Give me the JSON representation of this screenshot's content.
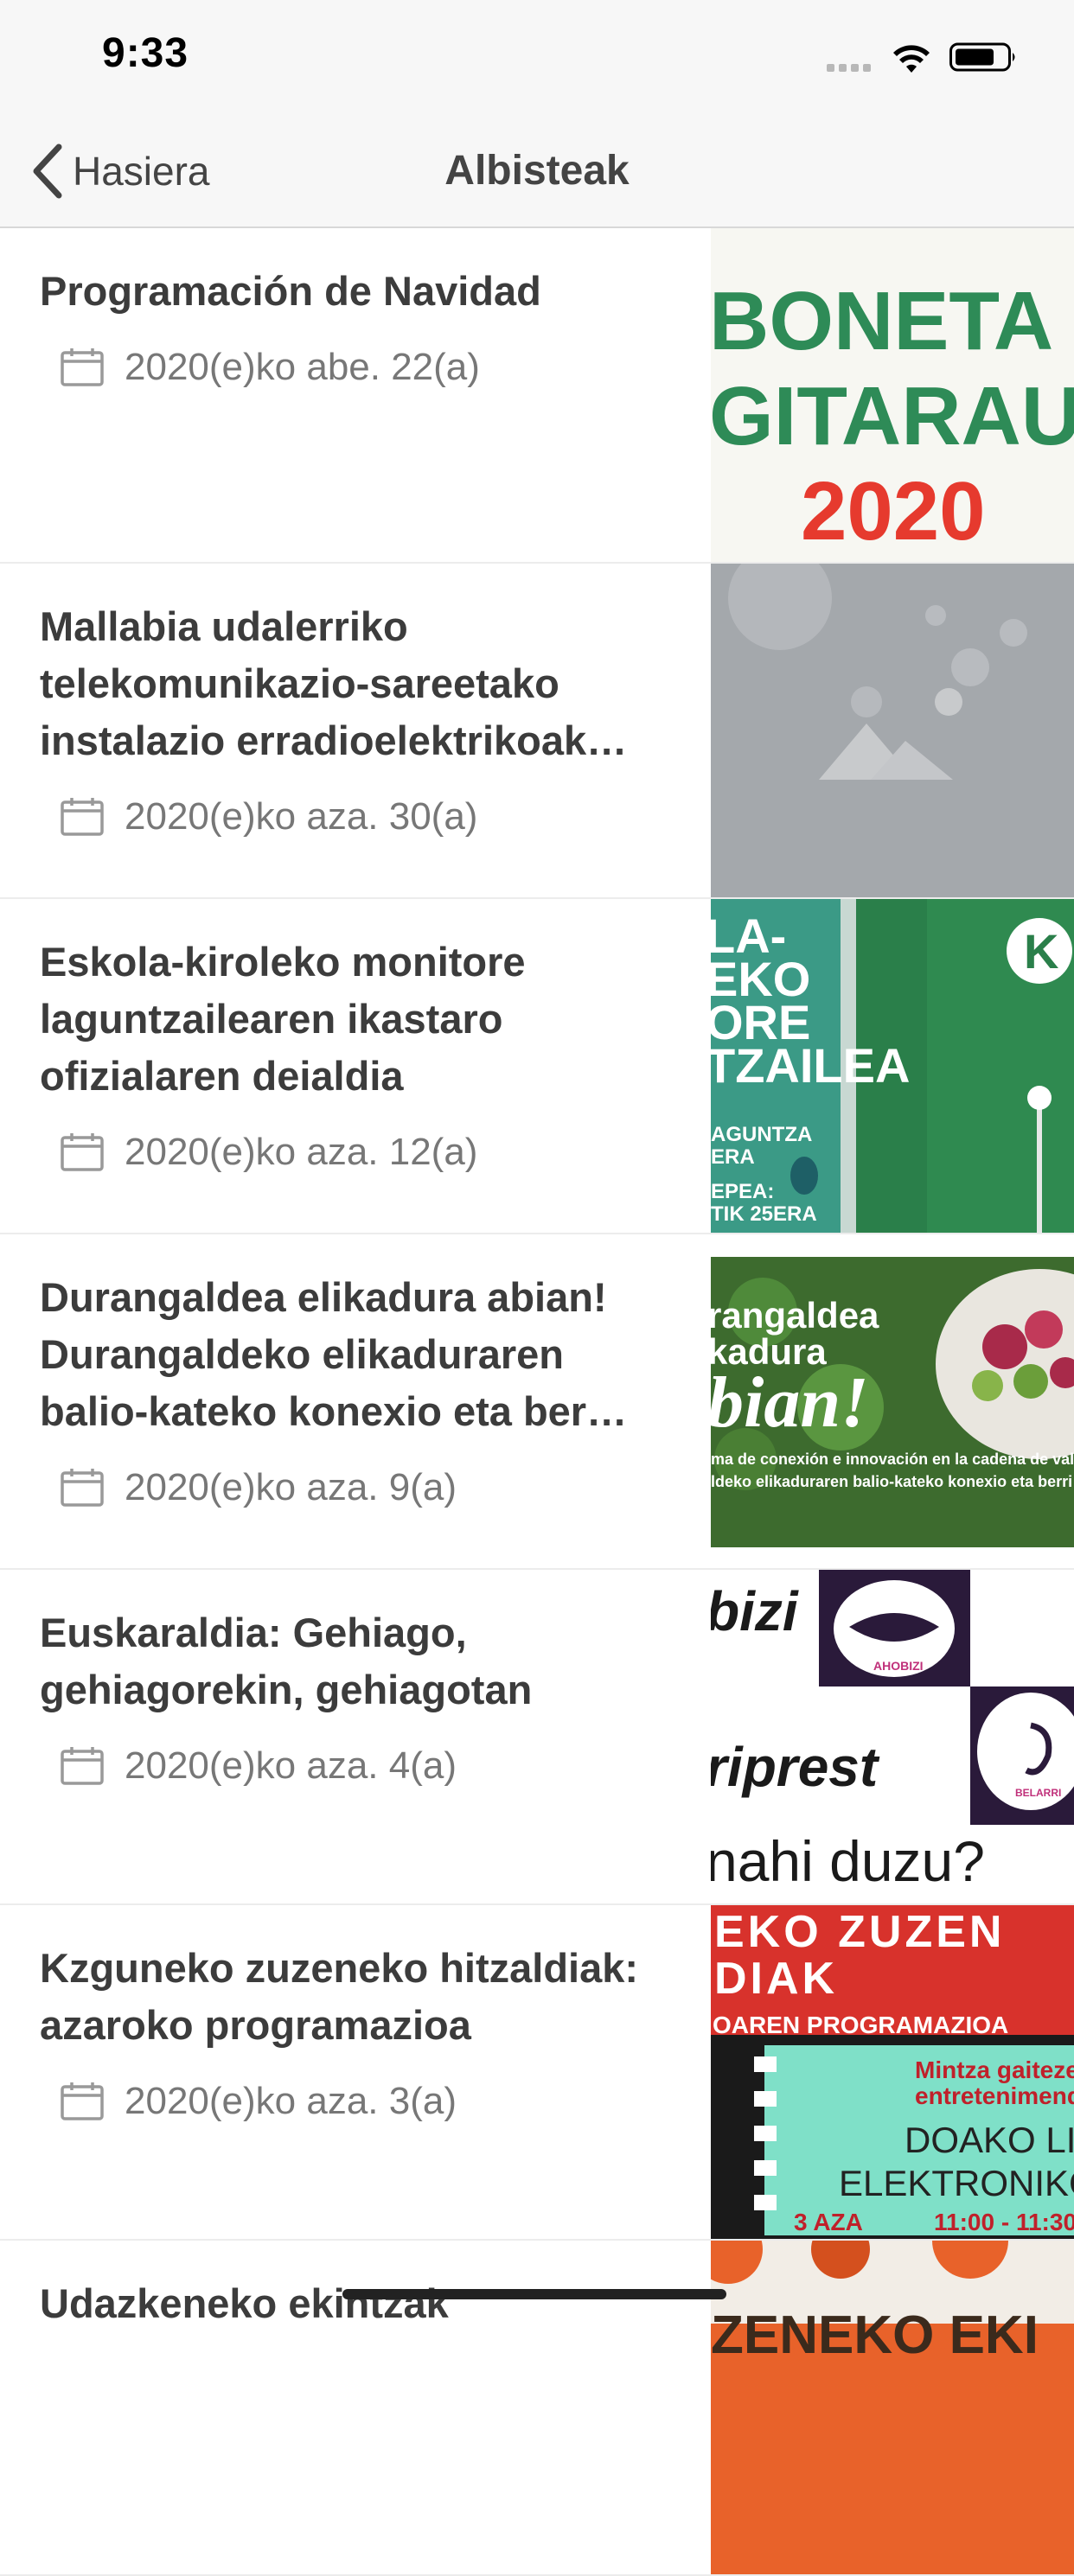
{
  "status": {
    "time": "9:33"
  },
  "nav": {
    "back_label": "Hasiera",
    "title": "Albisteak"
  },
  "news": [
    {
      "title": "Programación de Navidad",
      "date": "2020(e)ko abe. 22(a)",
      "thumb": {
        "lines": [
          "BONETA",
          "GITARAU",
          "2020"
        ],
        "bg": "#f7f7f2"
      }
    },
    {
      "title": "Mallabia udalerriko telekomunikazio-sareetako instalazio erradioelektrikoak…",
      "date": "2020(e)ko aza. 30(a)",
      "thumb": {
        "lines": [],
        "bg": "#a4a8ac"
      }
    },
    {
      "title": "Eskola-kiroleko monitore laguntzailearen ikastaro ofizialaren deialdia",
      "date": "2020(e)ko aza. 12(a)",
      "thumb": {
        "lines": [
          "LA-",
          "EKO",
          "ORE",
          "TZAILEA",
          "AGUNTZA",
          "ERA",
          "EPEA:",
          "TIK 25ERA"
        ],
        "bg": "#3b9a86"
      }
    },
    {
      "title": "Durangaldea elikadura abian! Durangaldeko elikaduraren balio-kateko konexio eta ber…",
      "date": "2020(e)ko aza. 9(a)",
      "thumb": {
        "lines": [
          "rangaldea",
          "kadura",
          "bian!",
          "ma de conexión e innovación en la cadena de valor",
          "ldeko elikaduraren balio-kateko konexio eta berri"
        ],
        "bg": "#3d6b2e"
      }
    },
    {
      "title": "Euskaraldia: Gehiago, gehiagorekin, gehiagotan",
      "date": "2020(e)ko aza. 4(a)",
      "thumb": {
        "lines": [
          "bizi",
          "AHOBIZI",
          "riprest",
          "BELARRI",
          "nahi duzu?"
        ],
        "bg": "#ffffff"
      }
    },
    {
      "title": "Kzguneko zuzeneko hitzaldiak: azaroko programazioa",
      "date": "2020(e)ko aza. 3(a)",
      "thumb": {
        "lines": [
          "EKO ZUZEN",
          "DIAK",
          "OAREN PROGRAMAZIOA",
          "Mintza gaitezen",
          "entretenimenduar",
          "DOAKO LIBU",
          "ELEKTRONIKOAK",
          "3 AZA",
          "11:00 - 11:30"
        ],
        "bg": "#d8322c"
      }
    },
    {
      "title": "Udazkeneko ekintzak",
      "date": "",
      "thumb": {
        "lines": [
          "ZENEKO EKI"
        ],
        "bg": "#e8622a"
      }
    }
  ]
}
